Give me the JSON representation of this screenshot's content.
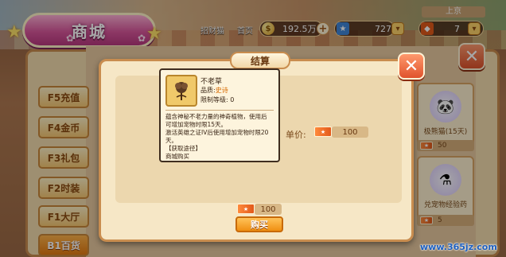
{
  "shop_title": "商城",
  "topbar": {
    "label_left": "招财猫",
    "label_mid": "首页",
    "coins": "192.5万",
    "coins_plus": "+",
    "tickets": "727",
    "region_label": "上京",
    "region_value": "7"
  },
  "sidebar": {
    "items": [
      {
        "label": "F5充值",
        "active": false
      },
      {
        "label": "F4金币",
        "active": false
      },
      {
        "label": "F3礼包",
        "active": false
      },
      {
        "label": "F2时装",
        "active": false
      },
      {
        "label": "F1大厅",
        "active": false
      },
      {
        "label": "B1百货",
        "active": true
      }
    ]
  },
  "right_items": [
    {
      "name": "极熊猫(15天)",
      "price": "50",
      "icon": "panda-icon"
    },
    {
      "name": "兑宠物经验药",
      "price": "5",
      "icon": "potion-icon"
    }
  ],
  "dialog": {
    "title": "结算",
    "unit_price_label": "单价:",
    "unit_price": "100",
    "total_price": "100",
    "buy_label": "购买"
  },
  "tooltip": {
    "name": "不老草",
    "quality_label": "品质:",
    "quality_value": "史诗",
    "level_label": "限制等级:",
    "level_value": "0",
    "description_lines": [
      "蕴含神秘不老力量的神奇植物，使用后",
      "可增加宠物时限15天。",
      "激活英雄之证IV后使用增加宠物时限20",
      "天。",
      "【获取途径】",
      "商城购买"
    ]
  },
  "watermark": "www.365jz.com",
  "colors": {
    "accent_orange": "#f08f12",
    "epic_quality": "#d86a00",
    "title_pink": "#d9579c"
  }
}
